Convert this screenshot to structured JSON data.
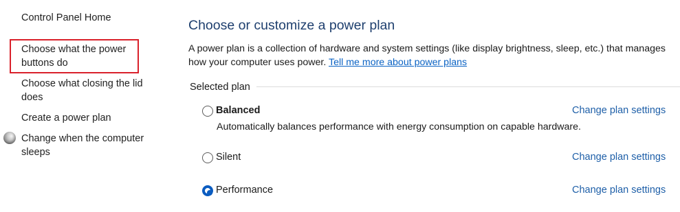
{
  "sidebar": {
    "home": "Control Panel Home",
    "power_buttons": "Choose what the power buttons do",
    "closing_lid": "Choose what closing the lid does",
    "create_plan": "Create a power plan",
    "computer_sleeps": "Change when the computer sleeps",
    "highlight_color": "#d9202a"
  },
  "main": {
    "title": "Choose or customize a power plan",
    "description": "A power plan is a collection of hardware and system settings (like display brightness, sleep, etc.) that manages how your computer uses power.",
    "learn_more_link": "Tell me more about power plans",
    "section_label": "Selected plan",
    "plans": [
      {
        "name": "Balanced",
        "selected": false,
        "bold": true,
        "description": "Automatically balances performance with energy consumption on capable hardware.",
        "change_link": "Change plan settings"
      },
      {
        "name": "Silent",
        "selected": false,
        "bold": false,
        "change_link": "Change plan settings"
      },
      {
        "name": "Performance",
        "selected": true,
        "bold": false,
        "change_link": "Change plan settings"
      }
    ]
  },
  "colors": {
    "title": "#1e3f6e",
    "link": "#0b63c4",
    "accent": "#0b5cc0"
  }
}
